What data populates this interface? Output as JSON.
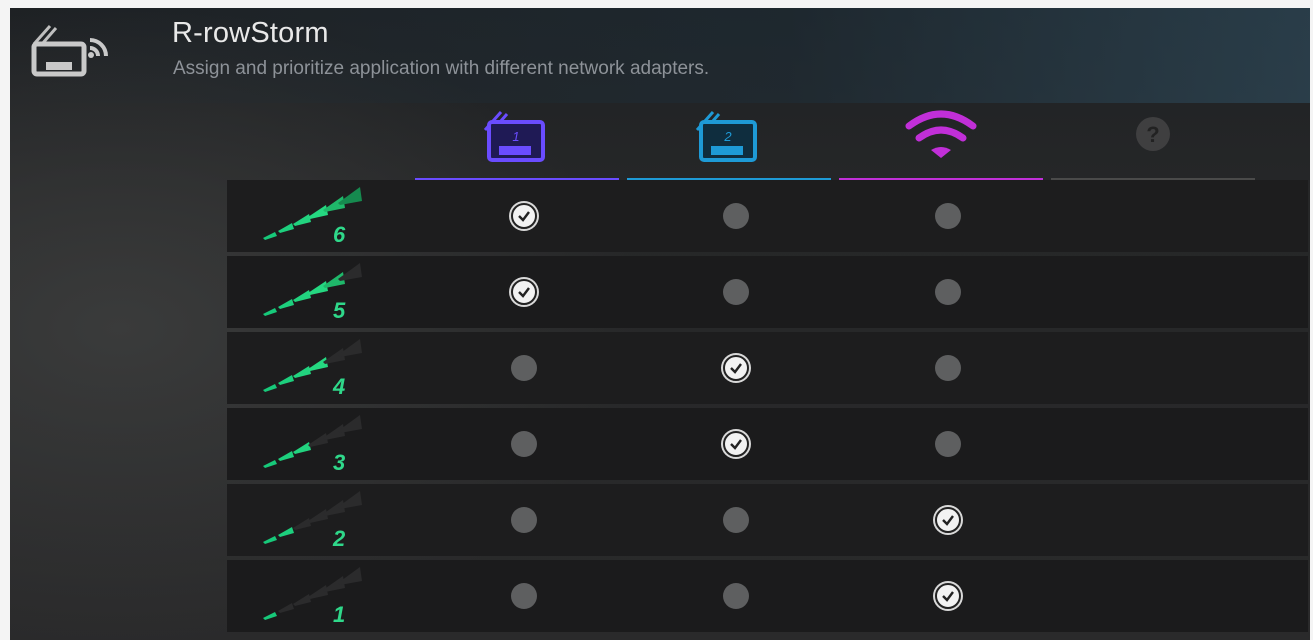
{
  "app": {
    "title": "R-rowStorm",
    "subtitle": "Assign and prioritize application with different network adapters."
  },
  "adapters": [
    {
      "name": "lan-1",
      "label": "1",
      "color": "#6a4cff"
    },
    {
      "name": "lan-2",
      "label": "2",
      "color": "#1e9ad6"
    },
    {
      "name": "wifi",
      "label": "",
      "color": "#c12fd8"
    },
    {
      "name": "help",
      "label": "?",
      "color": "#4a4a4a"
    }
  ],
  "priorities": [
    {
      "level": "6",
      "selected": 0
    },
    {
      "level": "5",
      "selected": 0
    },
    {
      "level": "4",
      "selected": 1
    },
    {
      "level": "3",
      "selected": 1
    },
    {
      "level": "2",
      "selected": 2
    },
    {
      "level": "1",
      "selected": 2
    }
  ],
  "icons": {
    "app": "lan-wifi-icon",
    "lan1": "ethernet-port-1-icon",
    "lan2": "ethernet-port-2-icon",
    "wifi": "wifi-icon",
    "help": "help-icon",
    "check": "check-icon"
  }
}
